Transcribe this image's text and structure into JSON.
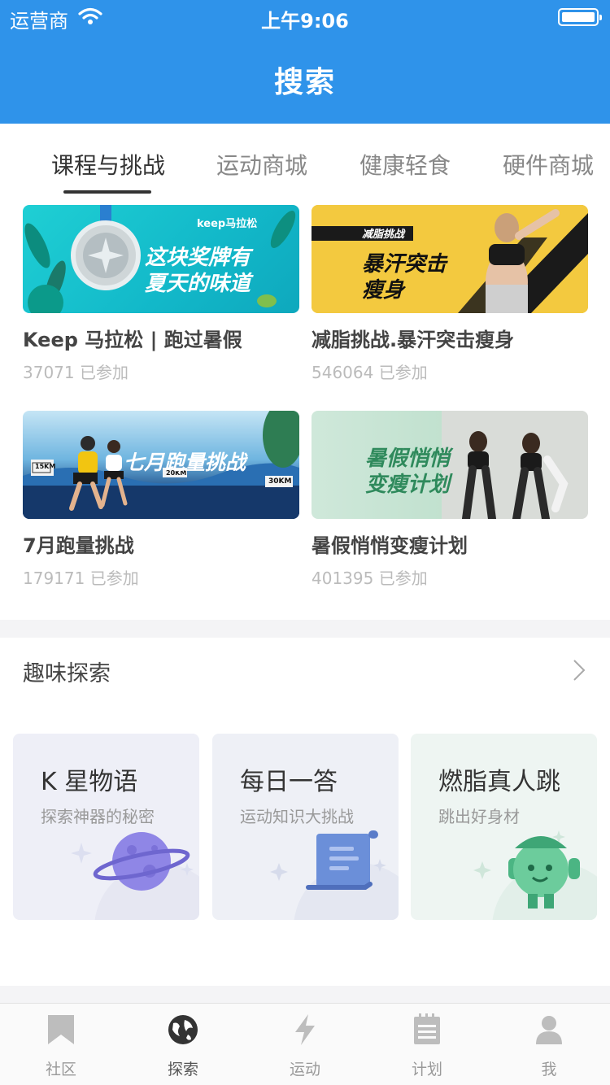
{
  "status_bar": {
    "carrier": "运营商",
    "time": "上午9:06"
  },
  "header": {
    "title": "搜索"
  },
  "tabs": [
    {
      "label": "课程与挑战",
      "active": true
    },
    {
      "label": "运动商城",
      "active": false
    },
    {
      "label": "健康轻食",
      "active": false
    },
    {
      "label": "硬件商城",
      "active": false
    }
  ],
  "courses": [
    {
      "title": "Keep 马拉松 | 跑过暑假",
      "count": "37071 已参加",
      "banner_text": [
        "这块奖牌有",
        "夏天的味道"
      ],
      "banner_brand": "keep马拉松"
    },
    {
      "title": "减脂挑战.暴汗突击瘦身",
      "count": "546064 已参加",
      "banner_text": [
        "暴汗突击",
        "瘦身"
      ],
      "banner_tag": "减脂挑战"
    },
    {
      "title": "7月跑量挑战",
      "count": "179171 已参加",
      "banner_text": [
        "七月跑量挑战"
      ],
      "banner_marks": [
        "15KM",
        "20KM",
        "30KM"
      ]
    },
    {
      "title": "暑假悄悄变瘦计划",
      "count": "401395 已参加",
      "banner_text": [
        "暑假悄悄",
        "变瘦计划"
      ]
    }
  ],
  "explore": {
    "title": "趣味探索",
    "cards": [
      {
        "title": "K 星物语",
        "subtitle": "探索神器的秘密",
        "bg": "#eeeff7",
        "icon": "planet-icon"
      },
      {
        "title": "每日一答",
        "subtitle": "运动知识大挑战",
        "bg": "#eef0f6",
        "icon": "scroll-icon"
      },
      {
        "title": "燃脂真人跳",
        "subtitle": "跳出好身材",
        "bg": "#eef5f2",
        "icon": "mascot-icon"
      }
    ]
  },
  "tabbar": [
    {
      "label": "社区",
      "icon": "bookmark-icon",
      "active": false
    },
    {
      "label": "探索",
      "icon": "globe-icon",
      "active": true
    },
    {
      "label": "运动",
      "icon": "lightning-icon",
      "active": false
    },
    {
      "label": "计划",
      "icon": "notepad-icon",
      "active": false
    },
    {
      "label": "我",
      "icon": "person-icon",
      "active": false
    }
  ],
  "colors": {
    "header": "#2f93ea",
    "text": "#333333",
    "muted": "#999999"
  }
}
